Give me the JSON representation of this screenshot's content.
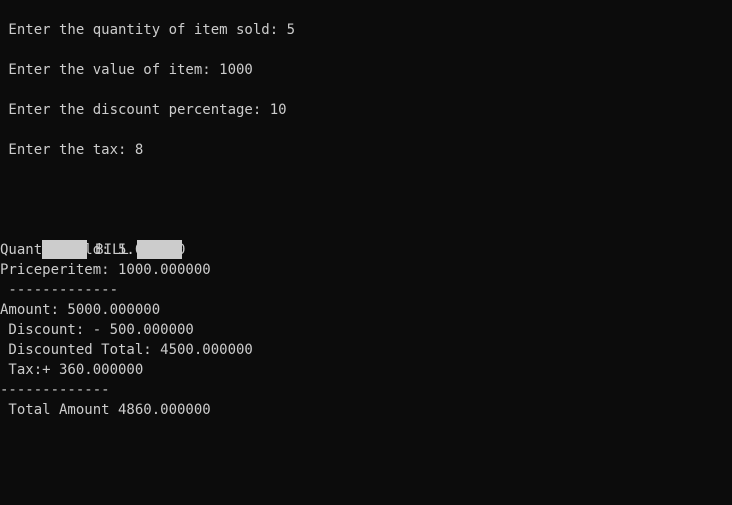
{
  "theme": {
    "background": "#0c0c0c",
    "foreground": "#cccccc"
  },
  "console": {
    "prompts": [
      " Enter the quantity of item sold: 5",
      " Enter the value of item: 1000",
      " Enter the discount percentage: 10",
      " Enter the tax: 8"
    ],
    "bill": {
      "heading": " BILL ",
      "lines": [
        "QuantitySold: 5.000000",
        "Priceperitem: 1000.000000",
        " -------------",
        "Amount: 5000.000000",
        " Discount: - 500.000000",
        " Discounted Total: 4500.000000",
        " Tax:+ 360.000000",
        "-------------",
        " Total Amount 4860.000000"
      ]
    }
  }
}
